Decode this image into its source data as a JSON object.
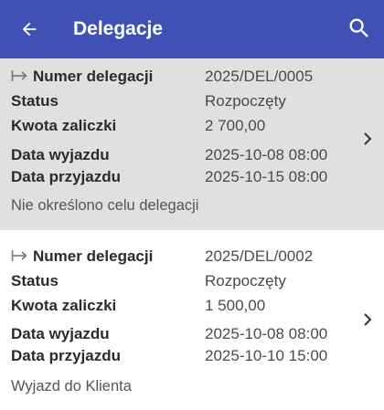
{
  "header": {
    "title": "Delegacje",
    "back_icon": "arrow-left-icon",
    "search_icon": "search-icon",
    "background": "#3f51b5"
  },
  "labels": {
    "number": "Numer delegacji",
    "status": "Status",
    "advance": "Kwota zaliczki",
    "departure": "Data wyjazdu",
    "arrival": "Data przyjazdu"
  },
  "delegations": [
    {
      "number": "2025/DEL/0005",
      "status": "Rozpoczęty",
      "advance": "2 700,00",
      "departure": "2025-10-08 08:00",
      "arrival": "2025-10-15 08:00",
      "purpose": "Nie określono celu delegacji",
      "selected": true
    },
    {
      "number": "2025/DEL/0002",
      "status": "Rozpoczęty",
      "advance": "1 500,00",
      "departure": "2025-10-08 08:00",
      "arrival": "2025-10-10 15:00",
      "purpose": "Wyjazd do Klienta",
      "selected": false
    }
  ]
}
